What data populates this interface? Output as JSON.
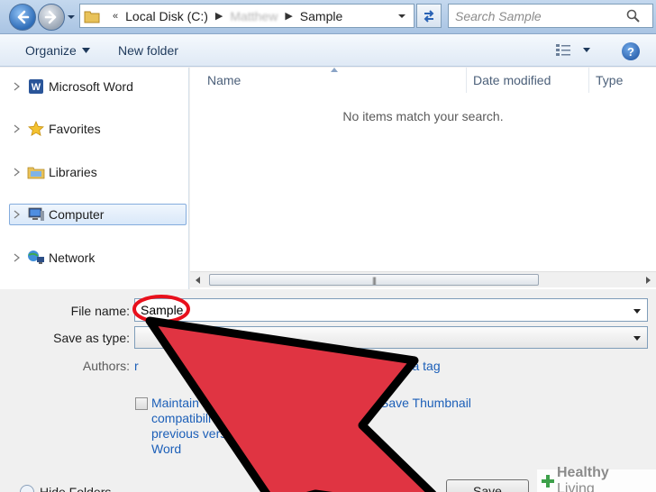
{
  "address_bar": {
    "path": [
      "Local Disk (C:)",
      "Matthew",
      "Sample"
    ],
    "search_placeholder": "Search Sample"
  },
  "toolbar": {
    "organize_label": "Organize",
    "new_folder_label": "New folder",
    "help_glyph": "?"
  },
  "nav": {
    "items": [
      {
        "label": "Microsoft Word",
        "icon": "word-icon"
      },
      {
        "label": "Favorites",
        "icon": "star-icon"
      },
      {
        "label": "Libraries",
        "icon": "libraries-icon"
      },
      {
        "label": "Computer",
        "icon": "computer-icon",
        "selected": true
      },
      {
        "label": "Network",
        "icon": "network-icon"
      }
    ]
  },
  "file_list": {
    "columns": [
      "Name",
      "Date modified",
      "Type"
    ],
    "empty_message": "No items match your search."
  },
  "form": {
    "file_name_label": "File name:",
    "file_name_value": "Sample",
    "save_as_type_label": "Save as type:",
    "save_as_type_value": "",
    "authors_label": "Authors:",
    "authors_value": "r",
    "tags_link": "dd a tag",
    "maintain_compat_lines": [
      "Maintain",
      "compatibili",
      "previous vers",
      "Word"
    ],
    "save_thumbnail_label": "Save Thumbnail",
    "hide_folders_label": "Hide Folders",
    "save_button_label": "Save"
  },
  "watermark": {
    "brand_bold": "Healthy",
    "brand_light": " Living"
  },
  "colors": {
    "annotation_red": "#e03442",
    "link_blue": "#1c5fb8",
    "watermark_green": "#3da04a"
  }
}
